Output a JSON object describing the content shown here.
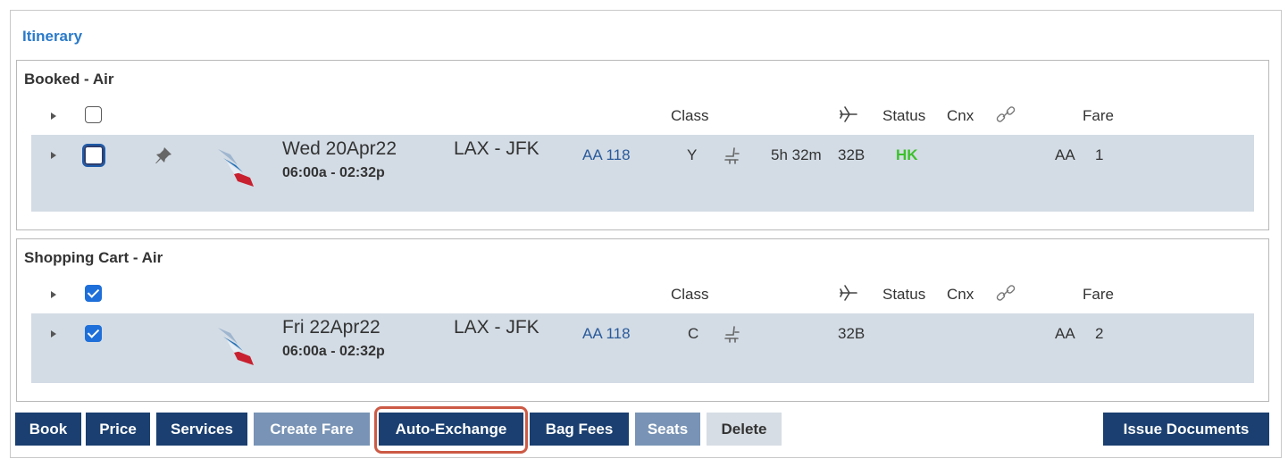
{
  "itinerary": {
    "title": "Itinerary"
  },
  "columns": {
    "class": "Class",
    "status": "Status",
    "cnx": "Cnx",
    "fare": "Fare"
  },
  "booked": {
    "title": "Booked - Air",
    "header_checked": false,
    "segment": {
      "checked": false,
      "date": "Wed 20Apr22",
      "times": "06:00a - 02:32p",
      "route": "LAX - JFK",
      "flight": "AA 118",
      "class": "Y",
      "duration": "5h 32m",
      "equipment": "32B",
      "status": "HK",
      "carrier": "AA",
      "fare": "1"
    }
  },
  "cart": {
    "title": "Shopping Cart - Air",
    "header_checked": true,
    "segment": {
      "checked": true,
      "date": "Fri 22Apr22",
      "times": "06:00a - 02:32p",
      "route": "LAX - JFK",
      "flight": "AA 118",
      "class": "C",
      "equipment": "32B",
      "carrier": "AA",
      "fare": "2"
    }
  },
  "toolbar": {
    "book": "Book",
    "price": "Price",
    "services": "Services",
    "create_fare": "Create Fare",
    "auto_exchange": "Auto-Exchange",
    "bag_fees": "Bag Fees",
    "seats": "Seats",
    "delete": "Delete",
    "issue_documents": "Issue Documents"
  },
  "colors": {
    "accent": "#1a3f70",
    "status_hk": "#3cc12c",
    "title_blue": "#2a7ac9",
    "highlight": "#cc5a45"
  }
}
